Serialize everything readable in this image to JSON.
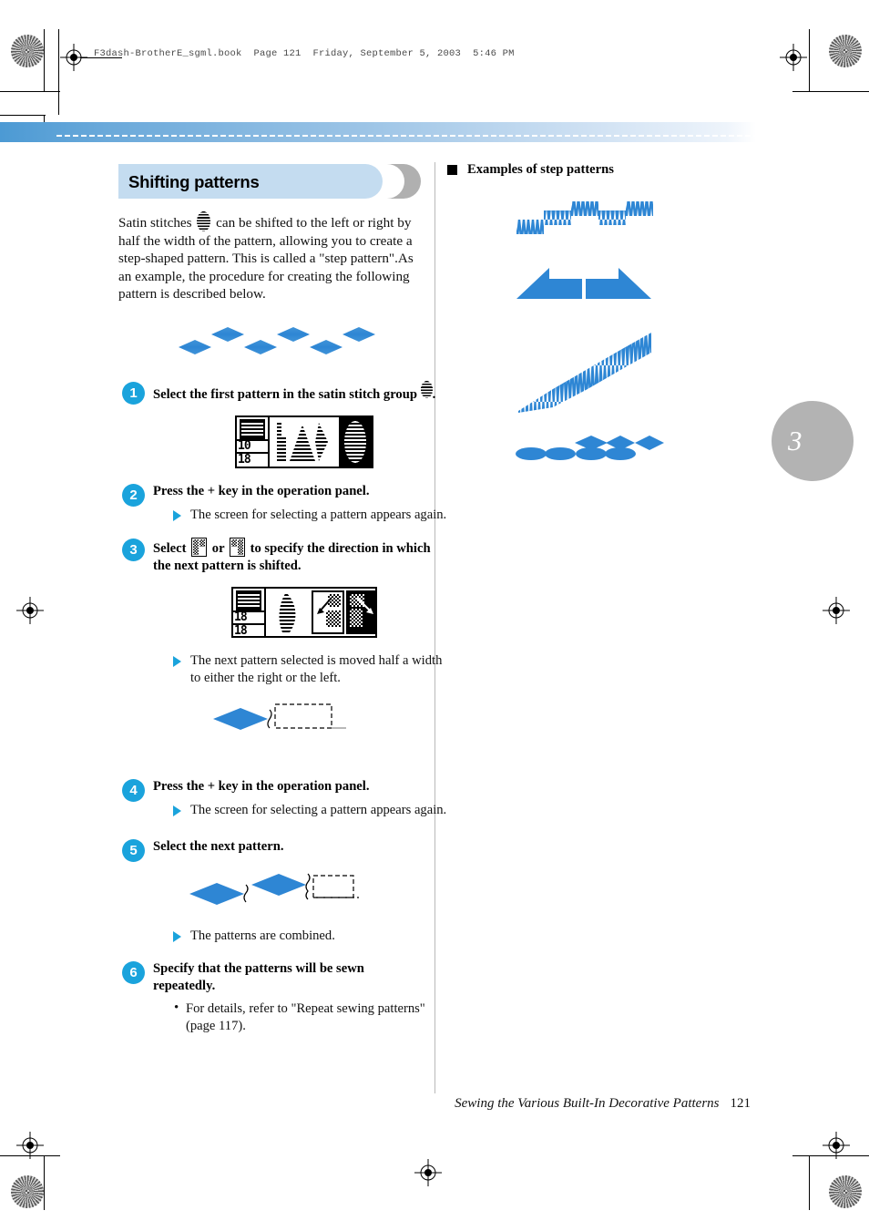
{
  "file_header": "F3dash-BrotherE_sgml.book  Page 121  Friday, September 5, 2003  5:46 PM",
  "colors": {
    "accent_blue": "#1aa3dc",
    "stitch_blue": "#2e86d4",
    "heading_band": "#c4dcf0",
    "tab_grey": "#b3b3b3"
  },
  "chapter_tab": {
    "number": "3"
  },
  "left_column": {
    "heading": "Shifting patterns",
    "intro_before_icon": "Satin stitches",
    "intro_after_icon": "can be shifted to the left or right by half the width of the pattern, allowing you to create a step-shaped pattern. This is called a \"step pattern\".As an example, the procedure for creating the following pattern is described below.",
    "steps": [
      {
        "number": "1",
        "title_before_icon": "Select the first pattern in the satin stitch group",
        "title_after_icon": ".",
        "lcd": {
          "num_top": "10",
          "num_bottom": "18"
        }
      },
      {
        "number": "2",
        "title": "Press the + key in the operation panel.",
        "result": "The screen for selecting a pattern appears again."
      },
      {
        "number": "3",
        "title_part1": "Select",
        "title_part2": "or",
        "title_part3": "to specify the direction in which the next pattern is shifted.",
        "lcd": {
          "num_top": "18",
          "num_bottom": "18"
        },
        "result": "The next pattern selected is moved half a width to either the right or the left."
      },
      {
        "number": "4",
        "title": "Press the + key in the operation panel.",
        "result": "The screen for selecting a pattern appears again."
      },
      {
        "number": "5",
        "title": "Select the next pattern.",
        "result": "The patterns are combined."
      },
      {
        "number": "6",
        "title": "Specify that the patterns will be sewn repeatedly.",
        "note": "For details, refer to \"Repeat sewing patterns\" (page 117)."
      }
    ]
  },
  "right_column": {
    "heading": "Examples of step patterns",
    "examples": [
      {
        "name": "staircase-zigzag-pattern"
      },
      {
        "name": "triangle-step-pattern"
      },
      {
        "name": "diagonal-ascending-step-pattern"
      },
      {
        "name": "diamond-oval-step-pattern"
      }
    ]
  },
  "footer": {
    "title": "Sewing the Various Built-In Decorative Patterns",
    "page_number": "121"
  }
}
